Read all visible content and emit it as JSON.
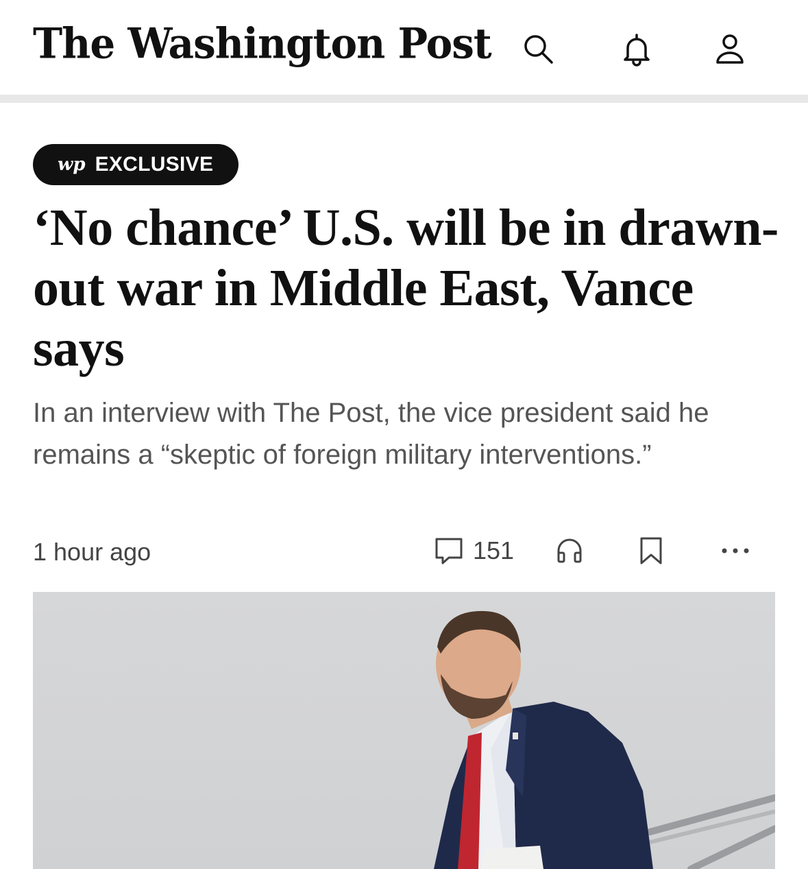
{
  "header": {
    "masthead": "The Washington Post",
    "icons": [
      "search-icon",
      "bell-icon",
      "user-icon"
    ]
  },
  "article": {
    "badge": {
      "logo": "wp",
      "label": "EXCLUSIVE"
    },
    "headline": "‘No chance’ U.S. will be in drawn-out war in Middle East, Vance says",
    "subhead": "In an interview with The Post, the vice president said he remains a “skeptic of foreign military interventions.”",
    "timestamp": "1 hour ago",
    "comment_count": "151",
    "action_icons": [
      "comment-icon",
      "headphones-icon",
      "bookmark-icon",
      "more-icon"
    ]
  },
  "colors": {
    "text": "#111111",
    "subhead": "#555555",
    "meta": "#444444",
    "badge_bg": "#111111",
    "divider": "#e8e8e8",
    "photo_bg": "#d4d5d7"
  }
}
